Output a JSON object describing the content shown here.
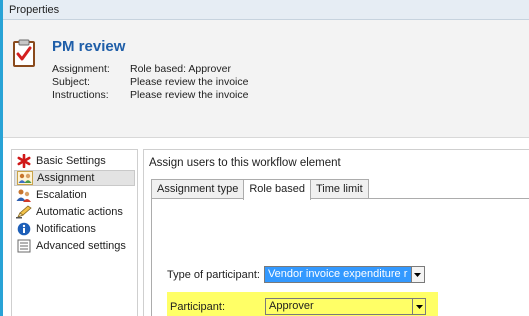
{
  "window": {
    "title": "Properties"
  },
  "header": {
    "title": "PM review",
    "meta": [
      {
        "label": "Assignment:",
        "value": "Role based: Approver"
      },
      {
        "label": "Subject:",
        "value": "Please review the invoice"
      },
      {
        "label": "Instructions:",
        "value": "Please review the invoice"
      }
    ]
  },
  "nav": {
    "items": [
      {
        "label": "Basic Settings",
        "icon": "red-star-icon"
      },
      {
        "label": "Assignment",
        "icon": "users-assignment-icon",
        "selected": true
      },
      {
        "label": "Escalation",
        "icon": "escalation-users-icon"
      },
      {
        "label": "Automatic actions",
        "icon": "pencil-icon"
      },
      {
        "label": "Notifications",
        "icon": "info-icon"
      },
      {
        "label": "Advanced settings",
        "icon": "settings-sheet-icon"
      }
    ]
  },
  "content": {
    "heading": "Assign users to this workflow element",
    "tabs": [
      {
        "label": "Assignment type",
        "active": false
      },
      {
        "label": "Role based",
        "active": true
      },
      {
        "label": "Time limit",
        "active": false
      }
    ],
    "participant_type": {
      "label": "Type of participant:",
      "value": "Vendor invoice expenditure r"
    },
    "participant": {
      "label": "Participant:",
      "value": "Approver"
    }
  },
  "colors": {
    "title_blue": "#1f5ea8",
    "selection_blue": "#3399ff",
    "highlight_yellow": "#ffff66",
    "frame_blue": "#29a3d6"
  }
}
